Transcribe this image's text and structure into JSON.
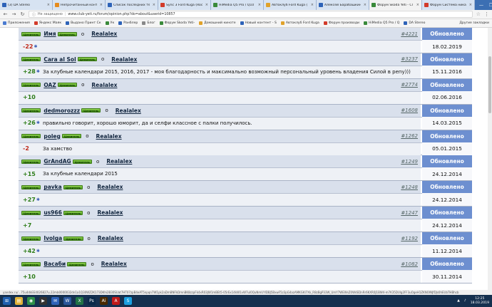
{
  "tabs": [
    {
      "label": "(3) DA Stereo",
      "color": "#2e63b8",
      "active": false
    },
    {
      "label": "Непрочитанный конт",
      "color": "#e58b1f",
      "active": false
    },
    {
      "label": "Список последних те",
      "color": "#2e63b8",
      "active": false
    },
    {
      "label": "Sync 3 Ford Kuga (Roc",
      "color": "#d23b2a",
      "active": false
    },
    {
      "label": "HiMedia Q5 Pro / Q10",
      "color": "#3a8a3a",
      "active": false
    },
    {
      "label": "Автоклуб Ford Kuga (",
      "color": "#e0a22a",
      "active": false
    },
    {
      "label": "Алексей Барабашкин",
      "color": "#2e63b8",
      "active": false
    },
    {
      "label": "Форум Skoda Yeti - Cl",
      "color": "#3a8a3a",
      "active": true
    },
    {
      "label": "Форум Система ника",
      "color": "#d23b2a",
      "active": false
    }
  ],
  "address": {
    "security": "Не защищено",
    "url": "www.club-yeti.ru/forum/opinion.php?do=about&userid=10857"
  },
  "bookmarks": [
    {
      "label": "Приложения",
      "color": "#4a7bd0"
    },
    {
      "label": "Яндекс Маяк",
      "color": "#d23b2a"
    },
    {
      "label": "Выдано Принт Ск",
      "color": "#2e63b8"
    },
    {
      "label": "Ук",
      "color": "#3a8a3a"
    },
    {
      "label": "Ранблер",
      "color": "#2e63b8"
    },
    {
      "label": "Блог",
      "color": "#888888"
    },
    {
      "label": "Форум Skoda Yeti-",
      "color": "#3a8a3a"
    },
    {
      "label": "Домашний кинотe",
      "color": "#e0a22a"
    },
    {
      "label": "Новый контент - S",
      "color": "#2e63b8"
    },
    {
      "label": "Автоклуб Ford Kuga",
      "color": "#e0a22a"
    },
    {
      "label": "Форум производи",
      "color": "#d23b2a"
    },
    {
      "label": "HiMedia Q5 Pro / Q",
      "color": "#3a8a3a"
    },
    {
      "label": "DA Stereo",
      "color": "#2e63b8"
    }
  ],
  "bookmarks_other": "Другие закладки",
  "badge_text": "Ценитель",
  "arrow_text": "о",
  "update_label": "Обновлено",
  "entries": [
    {
      "user": "Имя",
      "target": "Realalex",
      "num": "#4221",
      "score": "-22",
      "sign": "neg",
      "asterisk": true,
      "comment": "",
      "date": "18.02.2019"
    },
    {
      "user": "Cara al Sol",
      "target": "Realalex",
      "num": "#3237",
      "score": "+28",
      "sign": "pos",
      "asterisk": true,
      "comment": "За клубные календари 2015, 2016, 2017 - моя благодарность и максимально возможный персональный уровень владения Силой в репу)))",
      "date": "15.11.2016"
    },
    {
      "user": "OAZ",
      "target": "Realalex",
      "num": "#2774",
      "score": "+10",
      "sign": "pos",
      "asterisk": false,
      "comment": "",
      "date": "02.06.2016"
    },
    {
      "user": "dedmorozzz",
      "target": "Realalex",
      "num": "#1608",
      "score": "+26",
      "sign": "pos",
      "asterisk": true,
      "comment": "правильно говорит, хорошо юморит, да и селфи классное с палки получилось.",
      "date": "14.03.2015"
    },
    {
      "user": "poleg",
      "target": "Realalex",
      "num": "#1262",
      "score": "-2",
      "sign": "neg",
      "asterisk": false,
      "comment": "За хамство",
      "date": "05.01.2015"
    },
    {
      "user": "GrAndAG",
      "target": "Realalex",
      "num": "#1249",
      "score": "+15",
      "sign": "pos",
      "asterisk": false,
      "comment": "За клубные календари 2015",
      "date": "24.12.2014"
    },
    {
      "user": "pavka",
      "target": "Realalex",
      "num": "#1248",
      "score": "+27",
      "sign": "pos",
      "asterisk": true,
      "comment": "",
      "date": "24.12.2014"
    },
    {
      "user": "us966",
      "target": "Realalex",
      "num": "#1247",
      "score": "+7",
      "sign": "pos",
      "asterisk": false,
      "comment": "",
      "date": "24.12.2014"
    },
    {
      "user": "Ivolga",
      "target": "Realalex",
      "num": "#1192",
      "score": "+42",
      "sign": "pos",
      "asterisk": true,
      "comment": "",
      "date": "11.12.2014"
    },
    {
      "user": "Васаби",
      "target": "Realalex",
      "num": "#1082",
      "score": "+10",
      "sign": "pos",
      "asterisk": false,
      "comment": "",
      "date": "30.11.2014"
    }
  ],
  "status_url": "yandex.ru/...75u4dkEE4026827u.22mb0000032dn1a1Q30WZ2K173DKhi2B30SUat7HT07zpB4eAT5npqn7W1pk2aDmBNFkDmnBK8zzpFk4xR03JW1mBEt5-05rEx14kW1vW7ul0QuNmUYIDBJ5BxwF5z3pG4azAMKGKI7Xk_R8zBgP33W_UmY7WEWsZ0W4EDnRr6KXR0J1BW4-m7K35DUlg2FF3uOgeH1ZKNOlNJfDJs0hEUbTHBhcb",
  "clock": {
    "time": "12:25",
    "date": "18.03.2019"
  }
}
